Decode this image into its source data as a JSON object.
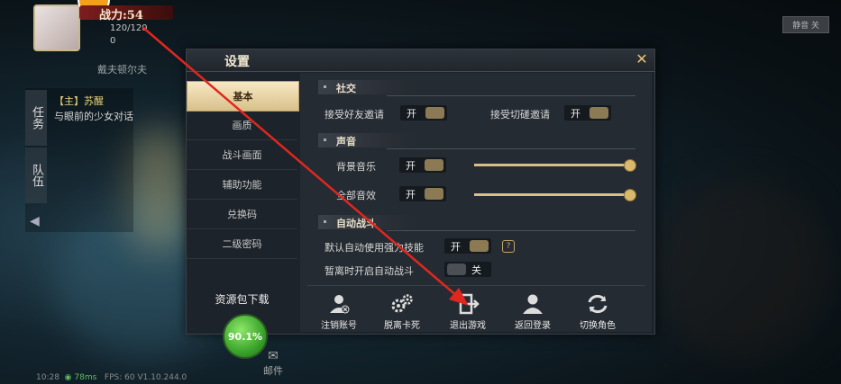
{
  "hud": {
    "power": "战力:54",
    "hp": "120/120",
    "mp": "0",
    "player_name": "戴夫顿尔夫",
    "top_right_button": "静音 关",
    "quest_tab": "任务",
    "team_tab": "队伍",
    "quest_title": "【主】苏醒",
    "quest_desc": "与眼前的少女对话",
    "mail_label": "邮件",
    "status": {
      "time": "10:28",
      "ping": "78ms",
      "fps": "FPS: 60 V1.10.244.0"
    }
  },
  "settings": {
    "title": "设置",
    "sidebar": [
      {
        "label": "基本",
        "active": true
      },
      {
        "label": "画质",
        "active": false
      },
      {
        "label": "战斗画面",
        "active": false
      },
      {
        "label": "辅助功能",
        "active": false
      },
      {
        "label": "兑换码",
        "active": false
      },
      {
        "label": "二级密码",
        "active": false
      }
    ],
    "resource_label": "资源包下载",
    "resource_progress": "90.1%",
    "sections": {
      "social": "社交",
      "sound": "声音",
      "auto_battle": "自动战斗"
    },
    "social": {
      "friend_invite": {
        "label": "接受好友邀请",
        "state": "开"
      },
      "duel_invite": {
        "label": "接受切磋邀请",
        "state": "开"
      }
    },
    "sound": {
      "bgm": {
        "label": "背景音乐",
        "state": "开",
        "level": 1.0
      },
      "sfx": {
        "label": "全部音效",
        "state": "开",
        "level": 1.0
      }
    },
    "auto": {
      "use_skills": {
        "label": "默认自动使用强力技能",
        "state": "开",
        "help": "?"
      },
      "auto_on_leave": {
        "label": "暂离时开启自动战斗",
        "state": "关"
      }
    },
    "actions": [
      {
        "label": "注销账号",
        "icon": "user-remove-icon"
      },
      {
        "label": "脱离卡死",
        "icon": "gears-icon"
      },
      {
        "label": "退出游戏",
        "icon": "exit-icon"
      },
      {
        "label": "返回登录",
        "icon": "user-icon"
      },
      {
        "label": "切换角色",
        "icon": "switch-icon"
      }
    ]
  },
  "colors": {
    "accent": "#d9c08a",
    "arrow": "#e0271f",
    "progress": "#3aa42a"
  }
}
